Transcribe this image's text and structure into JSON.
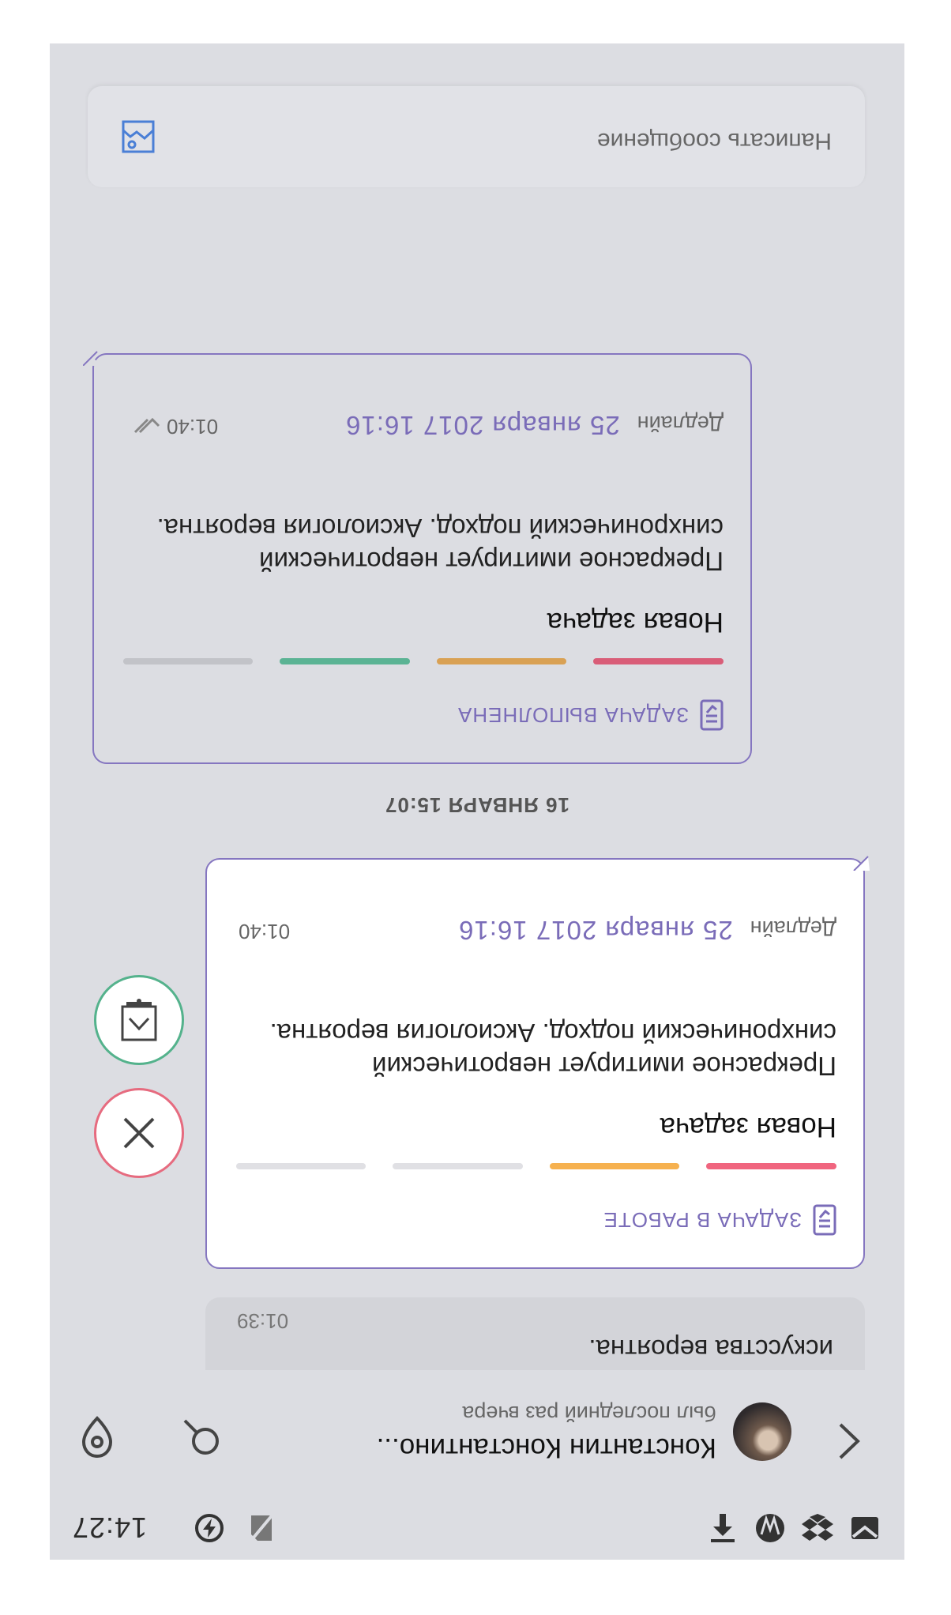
{
  "status_bar": {
    "time": "14:27"
  },
  "chat_header": {
    "title": "Константин Константино...",
    "subtitle": "был последний раз вчера"
  },
  "messages": {
    "partial": {
      "text": "искусства вероятна.",
      "time": "01:39"
    },
    "task_in_work": {
      "header": "ЗАДАЧА В РАБОТЕ",
      "title": "Новая задача",
      "body": "Прекрасное имитирует невротический синхронический подход. Аксиология вероятна.",
      "deadline_label": "Дедлайн",
      "deadline": "25 января 2017 16:16",
      "time": "01:40",
      "bar_colors": [
        "#f0657f",
        "#f6b14f",
        "#e0e0e4",
        "#e0e0e4"
      ]
    },
    "day_separator": "16 ЯНВАРЯ 15:07",
    "task_done": {
      "header": "ЗАДАЧА ВЫПОЛНЕНА",
      "title": "Новая задача",
      "body": "Прекрасное имитирует невротический синхронический подход. Аксиология вероятна.",
      "deadline_label": "Дедлайн",
      "deadline": "25 января 2017 16:16",
      "time": "01:40",
      "bar_colors": [
        "#d95d78",
        "#d9a154",
        "#5bb394",
        "#c2c3c8"
      ]
    }
  },
  "composer": {
    "placeholder": "Написать сообщение"
  },
  "colors": {
    "accent": "#7a6cb8",
    "reject": "#e66b7f",
    "accept": "#54b28c",
    "background": "#dcdde2"
  },
  "icons": {
    "status_left": [
      "gmail-icon",
      "dropbox-icon",
      "wordpress-icon",
      "upload-icon"
    ],
    "status_right": [
      "no-sim-icon",
      "data-saver-icon"
    ],
    "header": [
      "back-icon",
      "search-icon",
      "location-icon"
    ],
    "actions": [
      "reject-icon",
      "accept-icon"
    ],
    "composer": "attach-image-icon"
  }
}
